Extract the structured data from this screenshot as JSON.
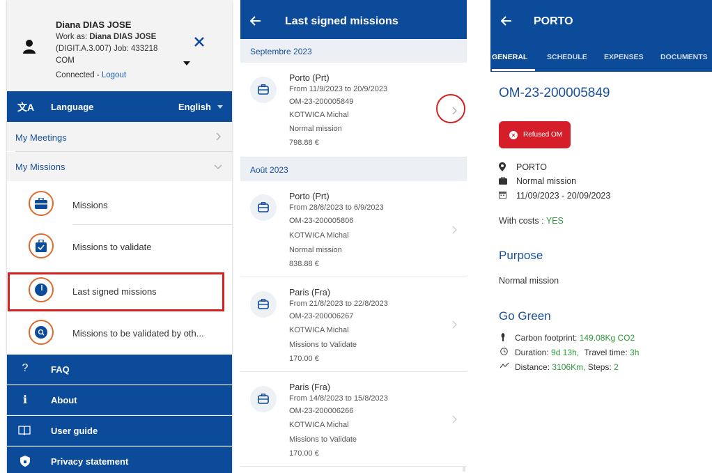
{
  "menu": {
    "user_name": "Diana DIAS JOSE",
    "work_as_prefix": "Work as:",
    "work_as_name": "Diana DIAS JOSE",
    "unit_line": "(DIGIT.A.3.007) Job: 433218",
    "com_line": "COM",
    "connected": "Connected -",
    "logout": "Logout",
    "language_label": "Language",
    "language_value": "English",
    "my_meetings": "My Meetings",
    "my_missions": "My Missions",
    "sub_items": [
      "Missions",
      "Missions to validate",
      "Last signed missions",
      "Missions to be validated by oth..."
    ],
    "bottom_items": [
      "FAQ",
      "About",
      "User guide",
      "Privacy statement"
    ]
  },
  "list": {
    "title": "Last signed missions",
    "months": [
      "Septembre 2023",
      "Août 2023"
    ],
    "missions": [
      {
        "city": "Porto (Prt)",
        "dates": "From 11/9/2023 to 20/9/2023",
        "ref": "OM-23-200005849",
        "person": "KOTWICA Michal",
        "type": "Normal mission",
        "amount": "798.88 €"
      },
      {
        "city": "Porto (Prt)",
        "dates": "From 28/8/2023 to 6/9/2023",
        "ref": "OM-23-200005806",
        "person": "KOTWICA Michal",
        "type": "Normal mission",
        "amount": "838.88 €"
      },
      {
        "city": "Paris (Fra)",
        "dates": "From 21/8/2023 to 22/8/2023",
        "ref": "OM-23-200006267",
        "person": "KOTWICA Michal",
        "type": "Missions to Validate",
        "amount": "170.00 €"
      },
      {
        "city": "Paris (Fra)",
        "dates": "From 14/8/2023 to 15/8/2023",
        "ref": "OM-23-200006266",
        "person": "KOTWICA Michal",
        "type": "Missions to Validate",
        "amount": "170.00 €"
      }
    ]
  },
  "detail": {
    "title": "PORTO",
    "tabs": [
      "GENERAL",
      "SCHEDULE",
      "EXPENSES",
      "DOCUMENTS"
    ],
    "om_ref": "OM-23-200005849",
    "status": "Refused OM",
    "location": "PORTO",
    "mission_type": "Normal mission",
    "period": "11/09/2023 - 20/09/2023",
    "costs_label": "With costs :",
    "costs_value": "YES",
    "purpose_title": "Purpose",
    "purpose_text": "Normal mission",
    "green_title": "Go Green",
    "carbon_label": "Carbon footprint:",
    "carbon_value": "149.08Kg CO2",
    "duration_label": "Duration:",
    "duration_value": "9d 13h,",
    "travel_label": "Travel time:",
    "travel_value": "3h",
    "distance_label": "Distance:",
    "distance_value": "3106Km,",
    "steps_label": "Steps:",
    "steps_value": "2"
  },
  "colors": {
    "primary": "#0c4a9a",
    "highlight": "#d62020",
    "accent_ring": "#e06a2c",
    "badge": "#d61e2a",
    "green": "#2e9a3a"
  }
}
